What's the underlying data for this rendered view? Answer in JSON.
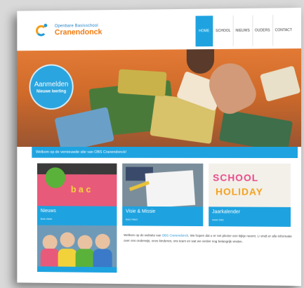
{
  "logo": {
    "line1": "Openbare Basisschool",
    "line2": "Cranendonck"
  },
  "nav": {
    "items": [
      {
        "label": "HOME",
        "active": true
      },
      {
        "label": "SCHOOL",
        "active": false
      },
      {
        "label": "NIEUWS",
        "active": false
      },
      {
        "label": "OUDERS",
        "active": false
      },
      {
        "label": "CONTACT",
        "active": false
      }
    ]
  },
  "hero": {
    "badge_title": "Aanmelden",
    "badge_subtitle": "Nieuwe leerling"
  },
  "welcome": {
    "text": "Welkom op de vernieuwde site van OBS Cranendonck!"
  },
  "cards": [
    {
      "title": "Nieuws",
      "more": "lees meer"
    },
    {
      "title": "Visie & Missie",
      "more": "lees meer"
    },
    {
      "title": "Jaarkalender",
      "more": "meer info"
    }
  ],
  "jaar_image": {
    "word1": "SCHOOL",
    "word2": "HOLIDAY"
  },
  "news_image": {
    "letters": "b a c"
  },
  "intro": {
    "before": "Welkom op de website van ",
    "link": "OBS Cranendonck",
    "after": ". We hopen dat u er net plezier een kijkje neemt. U vindt er alle informatie over ons onderwijs, onze kinderen, ons team en wat we verder nog belangrijk vinden."
  },
  "colors": {
    "accent": "#1ea3e0",
    "logo_orange": "#f07a10"
  }
}
